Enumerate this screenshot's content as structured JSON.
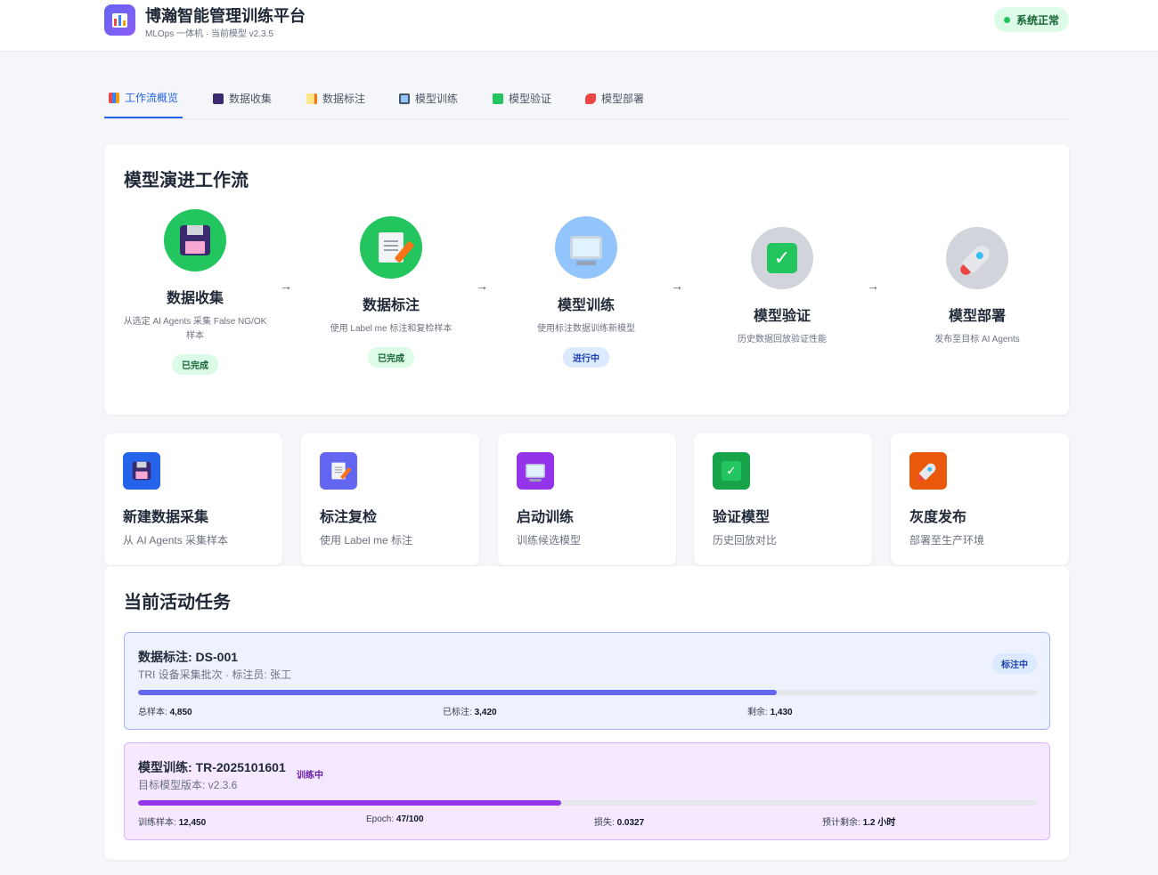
{
  "header": {
    "title": "博瀚智能管理训练平台",
    "subtitle": "MLOps 一体机 · 当前模型 v2.3.5",
    "status": "系统正常"
  },
  "tabs": [
    {
      "label": "工作流概览",
      "icon": "chart-icon",
      "active": true
    },
    {
      "label": "数据收集",
      "icon": "floppy-disk-icon"
    },
    {
      "label": "数据标注",
      "icon": "document-pen-icon"
    },
    {
      "label": "模型训练",
      "icon": "monitor-icon"
    },
    {
      "label": "模型验证",
      "icon": "check-box-icon"
    },
    {
      "label": "模型部署",
      "icon": "rocket-icon"
    }
  ],
  "workflow": {
    "title": "模型演进工作流",
    "arrow": "→",
    "steps": [
      {
        "name": "数据收集",
        "desc": "从选定 AI Agents 采集 False NG/OK 样本",
        "badge": "已完成",
        "icon": "floppy-disk-icon",
        "color": "#22c55e"
      },
      {
        "name": "数据标注",
        "desc": "使用 Label me 标注和复检样本",
        "badge": "已完成",
        "icon": "document-pen-icon",
        "color": "#22c55e"
      },
      {
        "name": "模型训练",
        "desc": "使用标注数据训练新模型",
        "badge": "进行中",
        "icon": "monitor-icon",
        "color": "#93c5fd"
      },
      {
        "name": "模型验证",
        "desc": "历史数据回放验证性能",
        "badge": "",
        "icon": "check-box-icon",
        "color": "#d1d5db"
      },
      {
        "name": "模型部署",
        "desc": "发布至目标 AI Agents",
        "badge": "",
        "icon": "rocket-icon",
        "color": "#d1d5db"
      }
    ]
  },
  "quick_actions": [
    {
      "title": "新建数据采集",
      "sub": "从 AI Agents 采集样本",
      "icon": "floppy-disk-icon",
      "color": "#2563eb"
    },
    {
      "title": "标注复检",
      "sub": "使用 Label me 标注",
      "icon": "document-pen-icon",
      "color": "#6366f1"
    },
    {
      "title": "启动训练",
      "sub": "训练候选模型",
      "icon": "monitor-icon",
      "color": "#9333ea"
    },
    {
      "title": "验证模型",
      "sub": "历史回放对比",
      "icon": "check-box-icon",
      "color": "#16a34a"
    },
    {
      "title": "灰度发布",
      "sub": "部署至生产环境",
      "icon": "rocket-icon",
      "color": "#ea580c"
    }
  ],
  "tasks": {
    "title": "当前活动任务",
    "items": [
      {
        "title": "数据标注: DS-001",
        "sub": "TRI 设备采集批次 · 标注员: 张工",
        "badge": "标注中",
        "progress": 0.71,
        "color": "#6366f1",
        "stats": [
          {
            "label": "总样本: ",
            "value": "4,850"
          },
          {
            "label": "已标注: ",
            "value": "3,420"
          },
          {
            "label": "剩余: ",
            "value": "1,430"
          }
        ]
      },
      {
        "title": "模型训练: TR-2025101601",
        "sub": "目标模型版本: v2.3.6",
        "badge": "训练中",
        "progress": 0.47,
        "color": "#9333ea",
        "stats": [
          {
            "label": "训练样本: ",
            "value": "12,450"
          },
          {
            "label": "Epoch: ",
            "value": "47/100"
          },
          {
            "label": "损失: ",
            "value": "0.0327"
          },
          {
            "label": "预计剩余: ",
            "value": "1.2 小时"
          }
        ]
      }
    ]
  }
}
